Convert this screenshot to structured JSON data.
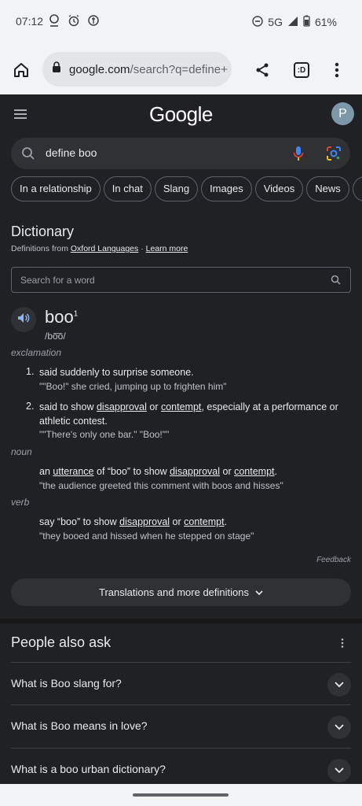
{
  "status_bar": {
    "time": "07:12",
    "network": "5G",
    "battery": "61%"
  },
  "browser": {
    "url_domain": "google.com",
    "url_path": "/search?q=define+",
    "tab_icon_label": ":D"
  },
  "google": {
    "logo": "Google",
    "avatar_letter": "P",
    "query": "define boo",
    "chips": [
      "In a relationship",
      "In chat",
      "Slang",
      "Images",
      "Videos",
      "News"
    ]
  },
  "dictionary": {
    "title": "Dictionary",
    "source_prefix": "Definitions from",
    "source_link": "Oxford Languages",
    "source_sep": "·",
    "learn_more": "Learn more",
    "search_placeholder": "Search for a word",
    "word": "boo",
    "superscript": "1",
    "pronunciation": "/bo͞o/",
    "exclamation": {
      "pos": "exclamation",
      "senses": [
        {
          "num": "1.",
          "parts": [
            "said suddenly to surprise someone."
          ],
          "example": "\"\"Boo!\" she cried, jumping up to frighten him\""
        },
        {
          "num": "2.",
          "parts": [
            "said to show ",
            "disapproval",
            " or ",
            "contempt",
            ", especially at a performance or athletic contest."
          ],
          "example": "\"\"There's only one bar.\" \"Boo!\"\""
        }
      ]
    },
    "noun": {
      "pos": "noun",
      "parts": [
        "an ",
        "utterance",
        " of “boo” to show ",
        "disapproval",
        " or ",
        "contempt",
        "."
      ],
      "example": "\"the audience greeted this comment with boos and hisses\""
    },
    "verb": {
      "pos": "verb",
      "parts": [
        "say “boo” to show ",
        "disapproval",
        " or ",
        "contempt",
        "."
      ],
      "example": "\"they booed and hissed when he stepped on stage\""
    },
    "feedback": "Feedback",
    "translations_button": "Translations and more definitions"
  },
  "people_also_ask": {
    "title": "People also ask",
    "questions": [
      "What is Boo slang for?",
      "What is Boo means in love?",
      "What is a boo urban dictionary?"
    ]
  },
  "colors": {
    "background": "#202124",
    "chrome": "#f2f3f4",
    "text": "#e8eaed",
    "muted": "#9aa0a6"
  }
}
